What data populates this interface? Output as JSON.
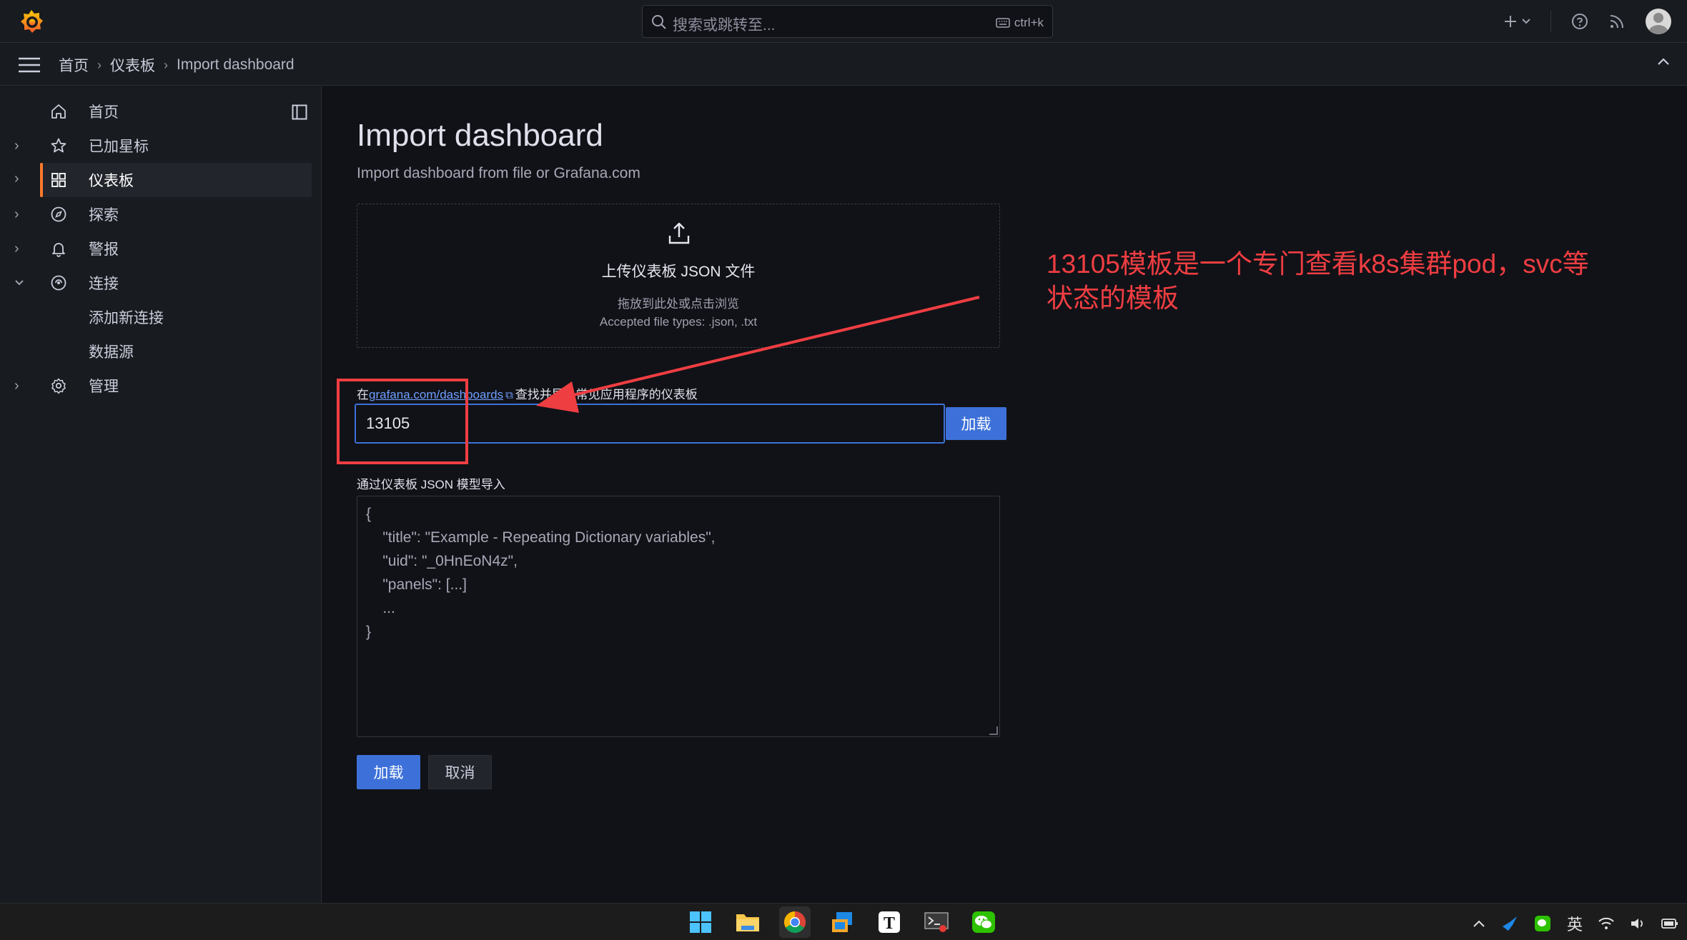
{
  "topbar": {
    "search_placeholder": "搜索或跳转至...",
    "search_shortcut": "ctrl+k",
    "icons": [
      "grafana-logo-icon",
      "search-icon",
      "keyboard-icon",
      "plus-icon",
      "help-icon",
      "rss-icon",
      "avatar"
    ]
  },
  "breadcrumb": {
    "home": "首页",
    "dashboards": "仪表板",
    "current": "Import dashboard"
  },
  "sidebar": {
    "items": [
      {
        "label": "首页",
        "icon": "home-icon"
      },
      {
        "label": "已加星标",
        "icon": "star-icon"
      },
      {
        "label": "仪表板",
        "icon": "apps-icon",
        "active": true
      },
      {
        "label": "探索",
        "icon": "compass-icon"
      },
      {
        "label": "警报",
        "icon": "bell-icon"
      },
      {
        "label": "连接",
        "icon": "link-icon",
        "expanded": true
      },
      {
        "label": "添加新连接",
        "sub": true
      },
      {
        "label": "数据源",
        "sub": true
      },
      {
        "label": "管理",
        "icon": "gear-icon"
      }
    ]
  },
  "page": {
    "title": "Import dashboard",
    "subtitle": "Import dashboard from file or Grafana.com"
  },
  "upload": {
    "heading": "上传仪表板 JSON 文件",
    "hint": "拖放到此处或点击浏览",
    "accepted": "Accepted file types: .json, .txt"
  },
  "grafana_com": {
    "prefix": "在",
    "link": "grafana.com/dashboards",
    "suffix": "查找并导入常见应用程序的仪表板",
    "input_value": "13105",
    "load_label": "加载"
  },
  "json_model": {
    "label": "通过仪表板 JSON 模型导入",
    "placeholder": "{\n    \"title\": \"Example - Repeating Dictionary variables\",\n    \"uid\": \"_0HnEoN4z\",\n    \"panels\": [...]\n    ...\n}"
  },
  "actions": {
    "load": "加载",
    "cancel": "取消"
  },
  "annotation": {
    "text": "13105模板是一个专门查看k8s集群pod，svc等状态的模板",
    "color": "#ef3e42"
  },
  "taskbar": {
    "apps": [
      "windows-start-icon",
      "file-explorer-icon",
      "chrome-icon",
      "remote-desktop-icon",
      "typora-icon",
      "snipping-tool-icon",
      "wechat-icon"
    ],
    "tray_lang": "英"
  },
  "colors": {
    "accent": "#3d71d9",
    "active_marker": "#ff7a2d",
    "background": "#111217",
    "panel": "#181b1f"
  }
}
